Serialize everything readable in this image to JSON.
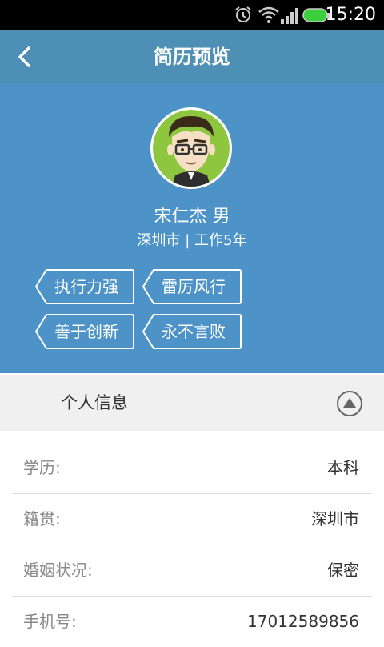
{
  "status_bar": {
    "time": "15:20",
    "icons": [
      "alarm-icon",
      "wifi-icon",
      "signal-icon",
      "battery-icon"
    ]
  },
  "header": {
    "title": "简历预览",
    "back_icon": "chevron-left-icon"
  },
  "profile": {
    "name_gender": "宋仁杰 男",
    "location_experience": "深圳市 | 工作5年",
    "tags": [
      "执行力强",
      "雷厉风行",
      "善于创新",
      "永不言败"
    ]
  },
  "section": {
    "title": "个人信息",
    "toggle_icon": "collapse-up-icon"
  },
  "info_rows": [
    {
      "label": "学历:",
      "value": "本科"
    },
    {
      "label": "籍贯:",
      "value": "深圳市"
    },
    {
      "label": "婚姻状况:",
      "value": "保密"
    },
    {
      "label": "手机号:",
      "value": "17012589856"
    }
  ],
  "colors": {
    "header": "#4e8fb5",
    "profile_bg": "#4d93c8",
    "section_bg": "#f0f0f0"
  }
}
